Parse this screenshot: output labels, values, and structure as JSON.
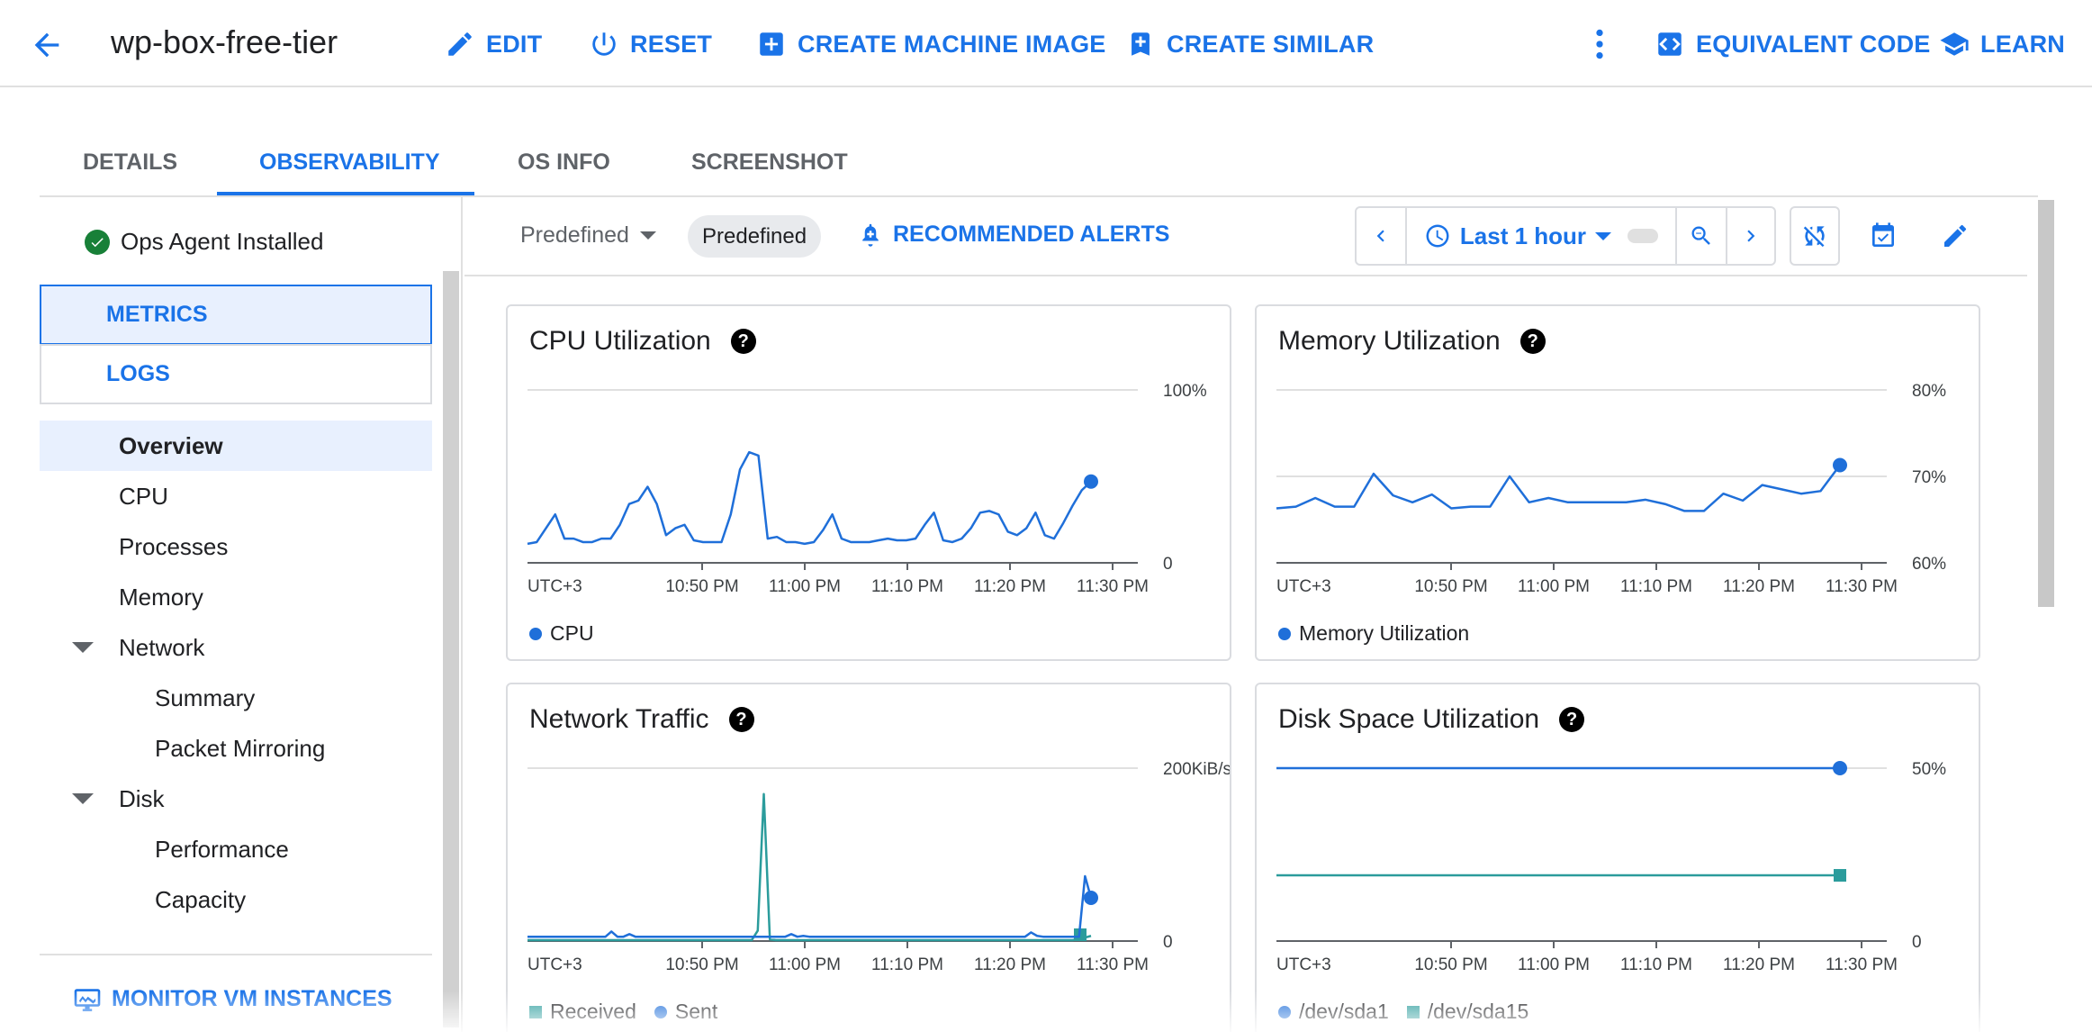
{
  "header": {
    "title": "wp-box-free-tier",
    "actions": {
      "edit": "EDIT",
      "reset": "RESET",
      "create_machine_image": "CREATE MACHINE IMAGE",
      "create_similar": "CREATE SIMILAR",
      "equivalent_code": "EQUIVALENT CODE",
      "learn": "LEARN"
    }
  },
  "tabs": [
    {
      "label": "DETAILS",
      "active": false
    },
    {
      "label": "OBSERVABILITY",
      "active": true
    },
    {
      "label": "OS INFO",
      "active": false
    },
    {
      "label": "SCREENSHOT",
      "active": false
    }
  ],
  "sidebar": {
    "ops_agent_status": "Ops Agent Installed",
    "segments": [
      {
        "label": "METRICS",
        "selected": true
      },
      {
        "label": "LOGS",
        "selected": false
      }
    ],
    "nav": [
      {
        "label": "Overview",
        "selected": true,
        "level": 0
      },
      {
        "label": "CPU",
        "level": 0
      },
      {
        "label": "Processes",
        "level": 0
      },
      {
        "label": "Memory",
        "level": 0
      },
      {
        "label": "Network",
        "level": 0,
        "expandable": true,
        "expanded": true
      },
      {
        "label": "Summary",
        "level": 1
      },
      {
        "label": "Packet Mirroring",
        "level": 1
      },
      {
        "label": "Disk",
        "level": 0,
        "expandable": true,
        "expanded": true
      },
      {
        "label": "Performance",
        "level": 1
      },
      {
        "label": "Capacity",
        "level": 1
      }
    ],
    "monitor_link": "MONITOR VM INSTANCES"
  },
  "toolbar": {
    "dashboard_dropdown": "Predefined",
    "dashboard_chip": "Predefined",
    "recommended_alerts": "RECOMMENDED ALERTS",
    "time_range": "Last 1 hour"
  },
  "colors": {
    "accent": "#1a73e8",
    "series_blue": "#1f6fd9",
    "series_teal": "#2b9c9c",
    "ok_green": "#188038"
  },
  "chart_data": [
    {
      "type": "line",
      "title": "CPU Utilization",
      "timezone": "UTC+3",
      "x_ticks": [
        "10:50 PM",
        "11:00 PM",
        "11:10 PM",
        "11:20 PM",
        "11:30 PM"
      ],
      "y_ticks": [
        "0",
        "100%"
      ],
      "ylim": [
        0,
        100
      ],
      "grid": true,
      "series": [
        {
          "name": "CPU",
          "color": "#1f6fd9",
          "values": [
            11,
            12,
            20,
            28,
            14,
            14,
            12,
            12,
            14,
            14,
            22,
            34,
            36,
            44,
            34,
            16,
            20,
            22,
            13,
            12,
            12,
            12,
            28,
            54,
            64,
            62,
            14,
            15,
            12,
            12,
            11,
            12,
            19,
            28,
            14,
            12,
            12,
            12,
            13,
            14,
            13,
            13,
            14,
            22,
            29,
            13,
            12,
            14,
            20,
            29,
            30,
            28,
            18,
            16,
            20,
            29,
            16,
            14,
            23,
            33,
            42,
            47
          ]
        }
      ]
    },
    {
      "type": "line",
      "title": "Memory Utilization",
      "timezone": "UTC+3",
      "x_ticks": [
        "10:50 PM",
        "11:00 PM",
        "11:10 PM",
        "11:20 PM",
        "11:30 PM"
      ],
      "y_ticks": [
        "60%",
        "70%",
        "80%"
      ],
      "ylim": [
        60,
        80
      ],
      "grid": true,
      "series": [
        {
          "name": "Memory Utilization",
          "color": "#1f6fd9",
          "values": [
            66.3,
            66.5,
            67.5,
            66.5,
            66.5,
            70.3,
            67.8,
            67.0,
            67.9,
            66.3,
            66.5,
            66.5,
            70.0,
            67.0,
            67.5,
            67.0,
            67.0,
            67.0,
            67.0,
            67.3,
            66.8,
            66.0,
            66.0,
            68.0,
            67.2,
            69.0,
            68.5,
            68.0,
            68.3,
            71.3
          ]
        }
      ]
    },
    {
      "type": "line",
      "title": "Network Traffic",
      "timezone": "UTC+3",
      "x_ticks": [
        "10:50 PM",
        "11:00 PM",
        "11:10 PM",
        "11:20 PM",
        "11:30 PM"
      ],
      "y_ticks": [
        "0",
        "200KiB/s"
      ],
      "ylim": [
        0,
        200
      ],
      "grid": true,
      "series": [
        {
          "name": "Received",
          "color": "#2b9c9c",
          "values": [
            1,
            1,
            1,
            1,
            1,
            1,
            1,
            1,
            1,
            1,
            1,
            1,
            1,
            1,
            1,
            1,
            1,
            1,
            1,
            1,
            1,
            1,
            1,
            1,
            1,
            1,
            1,
            1,
            1,
            1,
            1,
            1,
            1,
            1,
            1,
            1,
            1,
            1,
            12,
            170,
            2,
            1,
            1,
            1,
            1,
            1,
            1,
            1,
            1,
            1,
            1,
            1,
            1,
            1,
            1,
            1,
            1,
            1,
            1,
            1,
            1,
            1,
            1,
            1,
            1,
            1,
            1,
            1,
            1,
            1,
            1,
            1,
            1,
            1,
            1,
            1,
            1,
            1,
            1,
            1,
            1,
            1,
            1,
            1,
            1,
            1,
            1,
            1,
            1,
            1,
            1,
            3,
            4,
            6
          ]
        },
        {
          "name": "Sent",
          "color": "#1f6fd9",
          "values": [
            5,
            5,
            5,
            5,
            5,
            5,
            5,
            5,
            5,
            5,
            5,
            5,
            5,
            5,
            11,
            5,
            5,
            8,
            5,
            5,
            5,
            5,
            5,
            5,
            5,
            5,
            5,
            5,
            5,
            5,
            5,
            5,
            5,
            5,
            5,
            5,
            5,
            5,
            5,
            5,
            5,
            5,
            5,
            5,
            8,
            5,
            6,
            5,
            5,
            5,
            5,
            5,
            5,
            5,
            5,
            5,
            5,
            5,
            5,
            5,
            5,
            5,
            5,
            5,
            5,
            5,
            5,
            5,
            5,
            5,
            5,
            5,
            5,
            5,
            5,
            5,
            5,
            5,
            5,
            5,
            5,
            5,
            5,
            5,
            10,
            6,
            5,
            5,
            5,
            5,
            5,
            5,
            5,
            75,
            50
          ]
        }
      ]
    },
    {
      "type": "line",
      "title": "Disk Space Utilization",
      "timezone": "UTC+3",
      "x_ticks": [
        "10:50 PM",
        "11:00 PM",
        "11:10 PM",
        "11:20 PM",
        "11:30 PM"
      ],
      "y_ticks": [
        "0",
        "50%"
      ],
      "ylim": [
        0,
        50
      ],
      "grid": true,
      "series": [
        {
          "name": "/dev/sda1",
          "color": "#1f6fd9",
          "marker": "circle",
          "values": [
            50,
            50
          ]
        },
        {
          "name": "/dev/sda15",
          "color": "#2b9c9c",
          "marker": "square",
          "values": [
            19,
            19
          ]
        }
      ]
    }
  ]
}
